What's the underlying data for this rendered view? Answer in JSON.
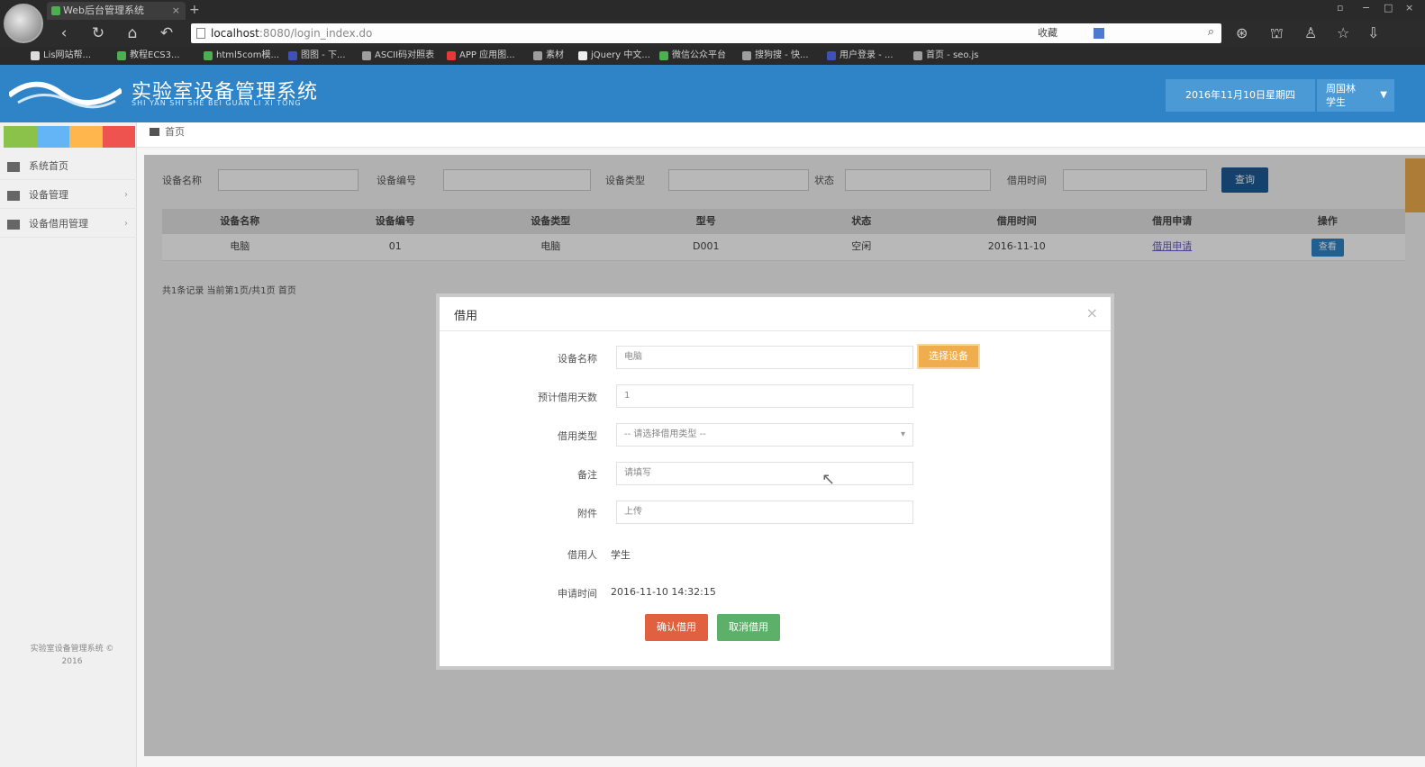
{
  "browser": {
    "tab_title": "Web后台管理系统",
    "url_host": "localhost",
    "url_path": ":8080/login_index.do",
    "url_fav": "收藏",
    "bookmarks": [
      {
        "label": "Lis网站帮...",
        "color": "#dddddd"
      },
      {
        "label": "教程ECS3...",
        "color": "#4caf50"
      },
      {
        "label": "html5com模...",
        "color": "#4caf50"
      },
      {
        "label": "图图 - 下...",
        "color": "#3f51b5"
      },
      {
        "label": "ASCII码对照表",
        "color": "#9e9e9e"
      },
      {
        "label": "APP 应用图...",
        "color": "#e53935"
      },
      {
        "label": "素材",
        "color": "#9e9e9e"
      },
      {
        "label": "jQuery 中文...",
        "color": "#eeeeee"
      },
      {
        "label": "微信公众平台",
        "color": "#4caf50"
      },
      {
        "label": "搜狗搜 - 快...",
        "color": "#9e9e9e"
      },
      {
        "label": "用户登录 - ...",
        "color": "#3f51b5"
      },
      {
        "label": "首页 - seo.js",
        "color": "#9e9e9e"
      }
    ]
  },
  "header": {
    "title": "实验室设备管理系统",
    "subtitle": "SHI YAN SHI SHE BEI GUAN LI XI TONG",
    "date": "2016年11月10日星期四",
    "user_line1": "周国林",
    "user_line2": "学生"
  },
  "sidebar": {
    "items": [
      {
        "label": "系统首页"
      },
      {
        "label": "设备管理"
      },
      {
        "label": "设备借用管理"
      }
    ],
    "footer": "实验室设备管理系统 © 2016"
  },
  "content": {
    "breadcrumb": "首页",
    "filters": {
      "labels": [
        "设备名称",
        "设备编号",
        "设备类型",
        "状态",
        "借用时间"
      ],
      "search_label": "查询"
    },
    "table": {
      "headers": [
        "设备名称",
        "设备编号",
        "设备类型",
        "型号",
        "状态",
        "借用时间",
        "借用申请",
        "操作"
      ],
      "rows": [
        {
          "cells": [
            "电脑",
            "01",
            "电脑",
            "D001",
            "空闲",
            "2016-11-10"
          ],
          "link": "借用申请",
          "action": "查看"
        }
      ]
    },
    "pager": "共1条记录 当前第1页/共1页 首页"
  },
  "modal": {
    "title": "借用",
    "fields": [
      {
        "label": "设备名称",
        "value": "电脑",
        "type": "input"
      },
      {
        "label": "预计借用天数",
        "value": "1",
        "type": "input"
      },
      {
        "label": "借用类型",
        "value": "-- 请选择借用类型 --",
        "type": "select"
      },
      {
        "label": "备注",
        "value": "请填写",
        "type": "input"
      },
      {
        "label": "附件",
        "value": "上传",
        "type": "input"
      },
      {
        "label": "借用人",
        "value": "学生",
        "type": "text"
      },
      {
        "label": "申请时间",
        "value": "2016-11-10 14:32:15",
        "type": "text"
      }
    ],
    "choose_label": "选择设备",
    "submit_label": "确认借用",
    "cancel_label": "取消借用"
  },
  "colors": {
    "header_blue": "#2e84c6",
    "search_blue": "#1e5b97",
    "orange": "#f0ad4e",
    "red": "#e0603f",
    "green": "#5cb06a"
  }
}
